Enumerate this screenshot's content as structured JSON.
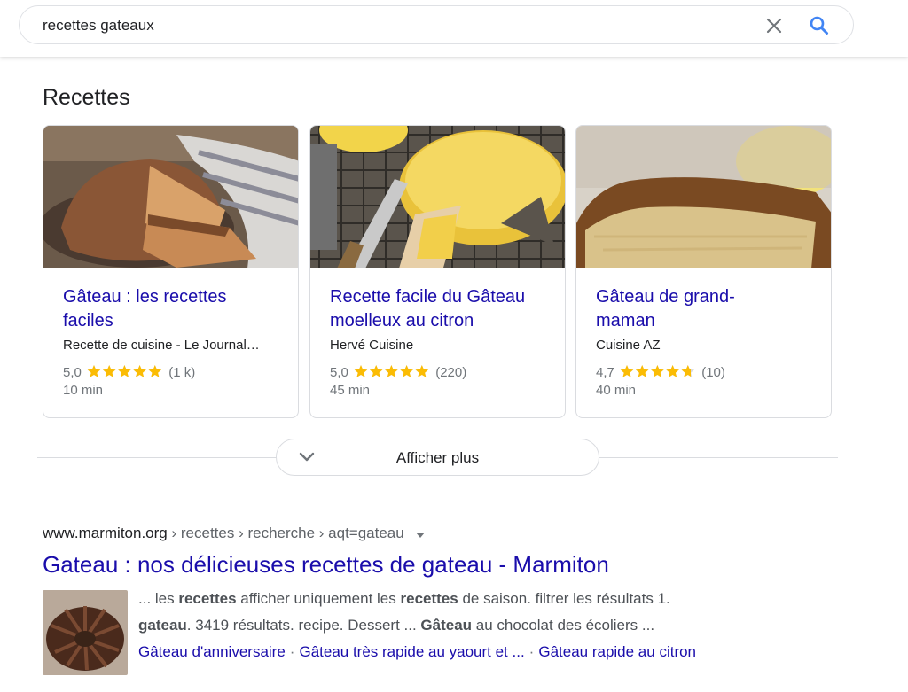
{
  "search": {
    "query": "recettes gateaux",
    "clear_icon": "close-icon",
    "search_icon": "search-icon"
  },
  "recipes": {
    "heading": "Recettes",
    "cards": [
      {
        "title_line1": "Gâteau : les recettes",
        "title_line2": "faciles",
        "source": "Recette de cuisine - Le Journal…",
        "rating_value": "5,0",
        "stars": 5.0,
        "reviews": "(1 k)",
        "time": "10 min",
        "image": "chocolate-sponge-cake-photo"
      },
      {
        "title_line1": "Recette facile du Gâteau",
        "title_line2": "moelleux au citron",
        "source": "Hervé Cuisine",
        "rating_value": "5,0",
        "stars": 5.0,
        "reviews": "(220)",
        "time": "45 min",
        "image": "lemon-cake-photo"
      },
      {
        "title_line1": "Gâteau de grand-",
        "title_line2": "maman",
        "source": "Cuisine AZ",
        "rating_value": "4,7",
        "stars": 4.7,
        "reviews": "(10)",
        "time": "40 min",
        "image": "loaf-cake-slice-photo"
      }
    ],
    "more_button": "Afficher plus",
    "more_icon": "chevron-down-icon"
  },
  "result": {
    "domain": "www.marmiton.org",
    "path": " › recettes › recherche › aqt=gateau",
    "title": "Gateau : nos délicieuses recettes de gateau - Marmiton",
    "thumb": "bundt-cake-photo",
    "snippet_line1": {
      "a": "... les ",
      "b1": "recettes",
      "c": " afficher uniquement les ",
      "b2": "recettes",
      "d": " de saison. filtrer les résultats 1."
    },
    "snippet_line2": {
      "b1": "gateau",
      "a": ". 3419 résultats. recipe. Dessert ... ",
      "b2": "Gâteau",
      "c": " au chocolat des écoliers ..."
    },
    "sitelinks": [
      "Gâteau d'anniversaire",
      "Gâteau très rapide au yaourt et ...",
      "Gâteau rapide au citron"
    ],
    "separator": "·"
  },
  "colors": {
    "link": "#1a0dab",
    "star": "#fbbc04",
    "accent_blue": "#4285f4"
  }
}
